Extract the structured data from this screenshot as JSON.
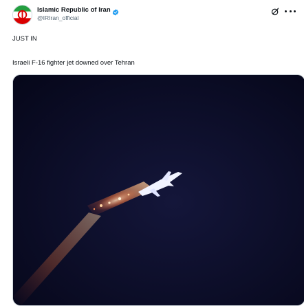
{
  "account": {
    "display_name": "Islamic Republic of Iran",
    "handle": "@IRIran_official",
    "verified_color": "#1d9bf0"
  },
  "post": {
    "text_line_1": "JUST IN",
    "text_line_2": "Israeli F-16 fighter jet downed over Tehran"
  },
  "icons": {
    "avatar": "iran-emblem-avatar",
    "verified": "verified-badge-icon",
    "grok": "grok-icon",
    "more": "more-options-icon"
  },
  "colors": {
    "media_background": "#07081c",
    "text_primary": "#0f1419",
    "text_secondary": "#536471"
  }
}
